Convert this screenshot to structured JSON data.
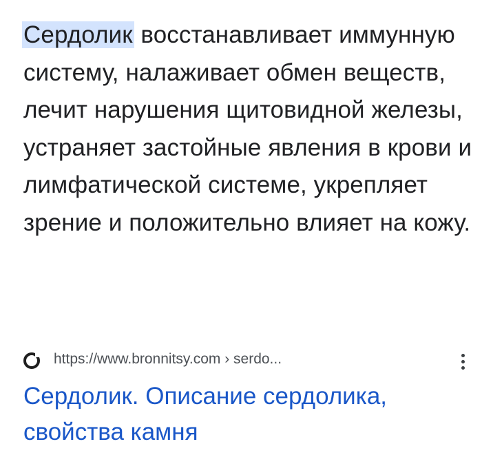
{
  "snippet": {
    "highlight": "Сердолик",
    "text": " восстанавливает иммунную систему, налаживает обмен веществ, лечит нарушения щитовидной железы, устраняет застойные явления в крови и лимфатической системе, укрепляет зрение и положительно влияет на кожу."
  },
  "result": {
    "favicon": "circle-logo-icon",
    "url": "https://www.bronnitsy.com › serdo...",
    "more_icon": "more-vert-icon",
    "title": "Сердолик. Описание сердолика, свойства камня"
  },
  "colors": {
    "text": "#202124",
    "highlight_bg": "#d3e3fd",
    "link": "#1a57c8",
    "url": "#4d5156"
  }
}
